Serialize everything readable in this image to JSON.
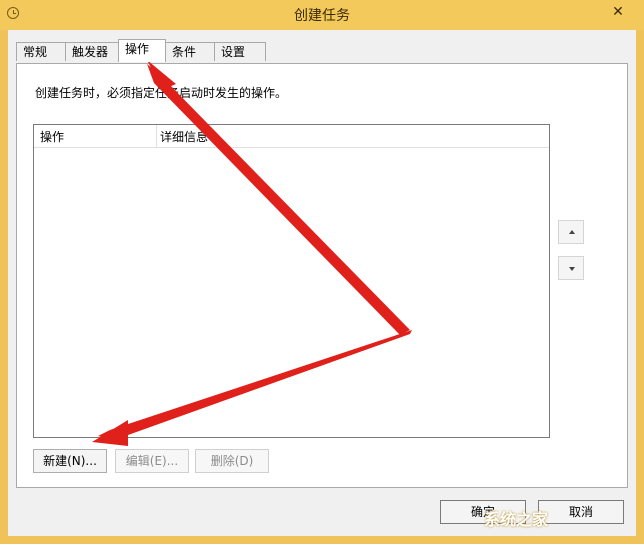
{
  "window": {
    "title": "创建任务",
    "close_glyph": "✕"
  },
  "tabs": [
    {
      "label": "常规"
    },
    {
      "label": "触发器"
    },
    {
      "label": "操作"
    },
    {
      "label": "条件"
    },
    {
      "label": "设置"
    }
  ],
  "panel": {
    "description": "创建任务时，必须指定任务启动时发生的操作。",
    "columns": [
      "操作",
      "详细信息"
    ]
  },
  "buttons": {
    "new": "新建(N)...",
    "edit": "编辑(E)...",
    "delete": "删除(D)"
  },
  "bottom": {
    "ok": "确定",
    "cancel": "取消"
  },
  "spinner": {
    "up_icon": "triangle-up-icon",
    "down_icon": "triangle-down-icon"
  },
  "annotations": {
    "arrow_color": "#e0201b"
  },
  "watermark": "系统之家"
}
